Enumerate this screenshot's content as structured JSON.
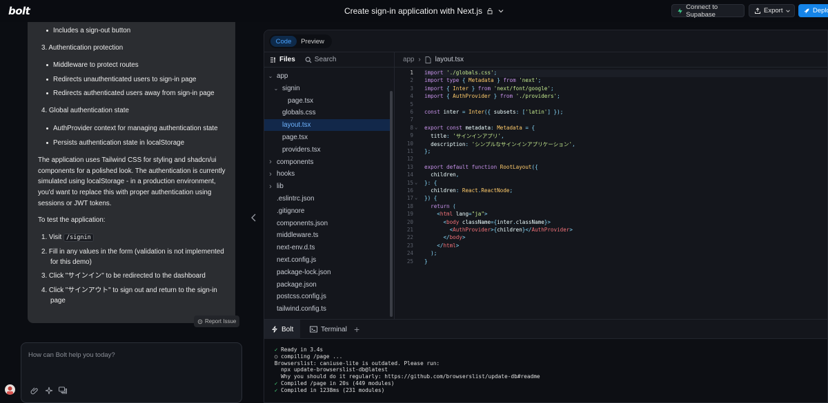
{
  "topbar": {
    "logo": "bolt",
    "project_title": "Create sign-in application with Next.js",
    "connect_supabase": "Connect to Supabase",
    "export": "Export",
    "deploy": "Deploy"
  },
  "chat": {
    "items": [
      {
        "kind": "ul",
        "text": "Includes a sign-out button"
      },
      {
        "kind": "ol",
        "text": "3. Authentication protection"
      },
      {
        "kind": "ul",
        "text": "Middleware to protect routes"
      },
      {
        "kind": "ul",
        "text": "Redirects unauthenticated users to sign-in page"
      },
      {
        "kind": "ul",
        "text": "Redirects authenticated users away from sign-in page"
      },
      {
        "kind": "ol",
        "text": "4. Global authentication state"
      },
      {
        "kind": "ul",
        "text": "AuthProvider context for managing authentication state"
      },
      {
        "kind": "ul",
        "text": "Persists authentication state in localStorage"
      }
    ],
    "para1": "The application uses Tailwind CSS for styling and shadcn/ui components for a polished look. The authentication is currently simulated using localStorage - in a production environment, you'd want to replace this with proper authentication using sessions or JWT tokens.",
    "para2": "To test the application:",
    "steps": {
      "s1_prefix": "1. Visit ",
      "s1_code": "/signin",
      "s2": "2. Fill in any values in the form (validation is not implemented",
      "s2b": "for this demo)",
      "s3": "3. Click \"サインイン\" to be redirected to the dashboard",
      "s4": "4. Click \"サインアウト\" to sign out and return to the sign-in",
      "s4b": "page"
    },
    "report_issue": "Report Issue",
    "input_placeholder": "How can Bolt help you today?"
  },
  "workbench": {
    "tabs": {
      "code": "Code",
      "preview": "Preview"
    },
    "files_label": "Files",
    "search_label": "Search",
    "tree": [
      {
        "name": "app",
        "type": "folder-open",
        "indent": 0
      },
      {
        "name": "signin",
        "type": "folder-open",
        "indent": 1
      },
      {
        "name": "page.tsx",
        "type": "file",
        "indent": 2
      },
      {
        "name": "globals.css",
        "type": "file",
        "indent": 1
      },
      {
        "name": "layout.tsx",
        "type": "file",
        "indent": 1,
        "selected": true
      },
      {
        "name": "page.tsx",
        "type": "file",
        "indent": 1
      },
      {
        "name": "providers.tsx",
        "type": "file",
        "indent": 1
      },
      {
        "name": "components",
        "type": "folder",
        "indent": 0
      },
      {
        "name": "hooks",
        "type": "folder",
        "indent": 0
      },
      {
        "name": "lib",
        "type": "folder",
        "indent": 0
      },
      {
        "name": ".eslintrc.json",
        "type": "file",
        "indent": 0
      },
      {
        "name": ".gitignore",
        "type": "file",
        "indent": 0
      },
      {
        "name": "components.json",
        "type": "file",
        "indent": 0
      },
      {
        "name": "middleware.ts",
        "type": "file",
        "indent": 0
      },
      {
        "name": "next-env.d.ts",
        "type": "file",
        "indent": 0
      },
      {
        "name": "next.config.js",
        "type": "file",
        "indent": 0
      },
      {
        "name": "package-lock.json",
        "type": "file",
        "indent": 0
      },
      {
        "name": "package.json",
        "type": "file",
        "indent": 0
      },
      {
        "name": "postcss.config.js",
        "type": "file",
        "indent": 0
      },
      {
        "name": "tailwind.config.ts",
        "type": "file",
        "indent": 0
      }
    ],
    "breadcrumb": {
      "folder": "app",
      "file": "layout.tsx"
    },
    "current_line": 1,
    "code_lines": [
      "import './globals.css';",
      "import type { Metadata } from 'next';",
      "import { Inter } from 'next/font/google';",
      "import { AuthProvider } from './providers';",
      "",
      "const inter = Inter({ subsets: ['latin'] });",
      "",
      "export const metadata: Metadata = {",
      "  title: 'サインインアプリ',",
      "  description: 'シンプルなサインインアプリケーション',",
      "};",
      "",
      "export default function RootLayout({",
      "  children,",
      "}: {",
      "  children: React.ReactNode;",
      "}) {",
      "  return (",
      "    <html lang=\"ja\">",
      "      <body className={inter.className}>",
      "        <AuthProvider>{children}</AuthProvider>",
      "      </body>",
      "    </html>",
      "  );",
      "}"
    ],
    "fold_lines": [
      8,
      15,
      17
    ],
    "terminal": {
      "tab_bolt": "Bolt",
      "tab_terminal": "Terminal",
      "lines": [
        {
          "ok": true,
          "text": "Ready in 3.4s"
        },
        {
          "ok": false,
          "text": "○ compiling /page ..."
        },
        {
          "ok": false,
          "text": "Browserslist: caniuse-lite is outdated. Please run:"
        },
        {
          "ok": false,
          "text": "  npx update-browserslist-db@latest"
        },
        {
          "ok": false,
          "text": "  Why you should do it regularly: https://github.com/browserslist/update-db#readme"
        },
        {
          "ok": true,
          "text": "Compiled /page in 20s (449 modules)"
        },
        {
          "ok": true,
          "text": "Compiled in 1238ms (231 modules)"
        }
      ]
    }
  }
}
